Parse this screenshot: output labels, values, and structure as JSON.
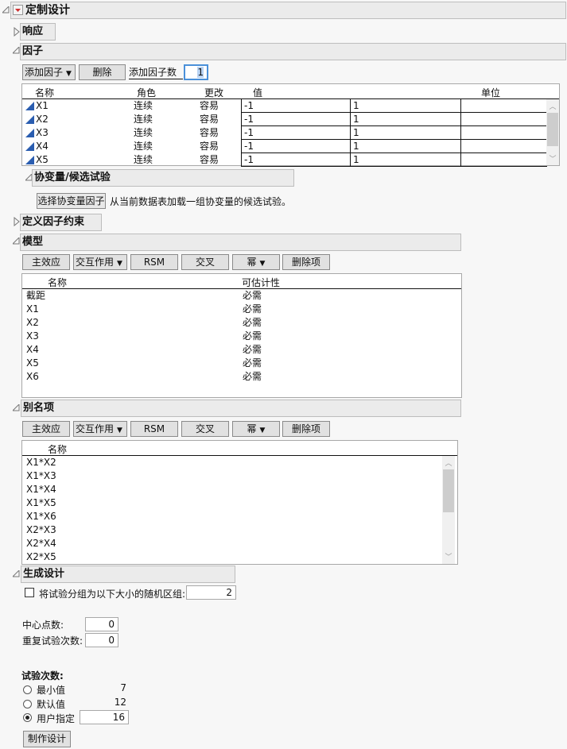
{
  "title": "定制设计",
  "sections": {
    "response": "响应",
    "factors": "因子",
    "covariates": "协变量/候选试验",
    "constraints": "定义因子约束",
    "model": "模型",
    "alias": "别名项",
    "generate": "生成设计"
  },
  "factors": {
    "add_factor_label": "添加因子",
    "delete_label": "删除",
    "add_count_label": "添加因子数",
    "add_count_value": "1",
    "columns": {
      "name": "名称",
      "role": "角色",
      "changes": "更改",
      "values": "值",
      "units": "单位"
    },
    "rows": [
      {
        "name": "X1",
        "role": "连续",
        "changes": "容易",
        "low": "-1",
        "high": "1",
        "units": ""
      },
      {
        "name": "X2",
        "role": "连续",
        "changes": "容易",
        "low": "-1",
        "high": "1",
        "units": ""
      },
      {
        "name": "X3",
        "role": "连续",
        "changes": "容易",
        "low": "-1",
        "high": "1",
        "units": ""
      },
      {
        "name": "X4",
        "role": "连续",
        "changes": "容易",
        "low": "-1",
        "high": "1",
        "units": ""
      },
      {
        "name": "X5",
        "role": "连续",
        "changes": "容易",
        "low": "-1",
        "high": "1",
        "units": ""
      }
    ]
  },
  "covariates": {
    "button_label": "选择协变量因子",
    "description": "从当前数据表加载一组协变量的候选试验。"
  },
  "model_toolbar": {
    "main_effects": "主效应",
    "interactions": "交互作用",
    "rsm": "RSM",
    "cross": "交叉",
    "powers": "幂",
    "remove": "删除项"
  },
  "model": {
    "columns": {
      "name": "名称",
      "estimability": "可估计性"
    },
    "rows": [
      {
        "name": "截距",
        "estimability": "必需"
      },
      {
        "name": "X1",
        "estimability": "必需"
      },
      {
        "name": "X2",
        "estimability": "必需"
      },
      {
        "name": "X3",
        "estimability": "必需"
      },
      {
        "name": "X4",
        "estimability": "必需"
      },
      {
        "name": "X5",
        "estimability": "必需"
      },
      {
        "name": "X6",
        "estimability": "必需"
      }
    ]
  },
  "alias": {
    "columns": {
      "name": "名称"
    },
    "rows": [
      "X1*X2",
      "X1*X3",
      "X1*X4",
      "X1*X5",
      "X1*X6",
      "X2*X3",
      "X2*X4",
      "X2*X5"
    ]
  },
  "generate": {
    "group_label": "将试验分组为以下大小的随机区组:",
    "group_value": "2",
    "group_checked": false,
    "center_points_label": "中心点数:",
    "center_points_value": "0",
    "replicates_label": "重复试验次数:",
    "replicates_value": "0",
    "runs_label": "试验次数:",
    "runs_options": [
      {
        "label": "最小值",
        "value": "7",
        "selected": false
      },
      {
        "label": "默认值",
        "value": "12",
        "selected": false
      },
      {
        "label": "用户指定",
        "value": "16",
        "selected": true
      }
    ],
    "make_design_label": "制作设计"
  },
  "colors": {
    "factor_icon": "#2a5db0",
    "red_menu": "#d03030",
    "header_bg": "#ebebeb",
    "focus": "#4a90d9"
  }
}
